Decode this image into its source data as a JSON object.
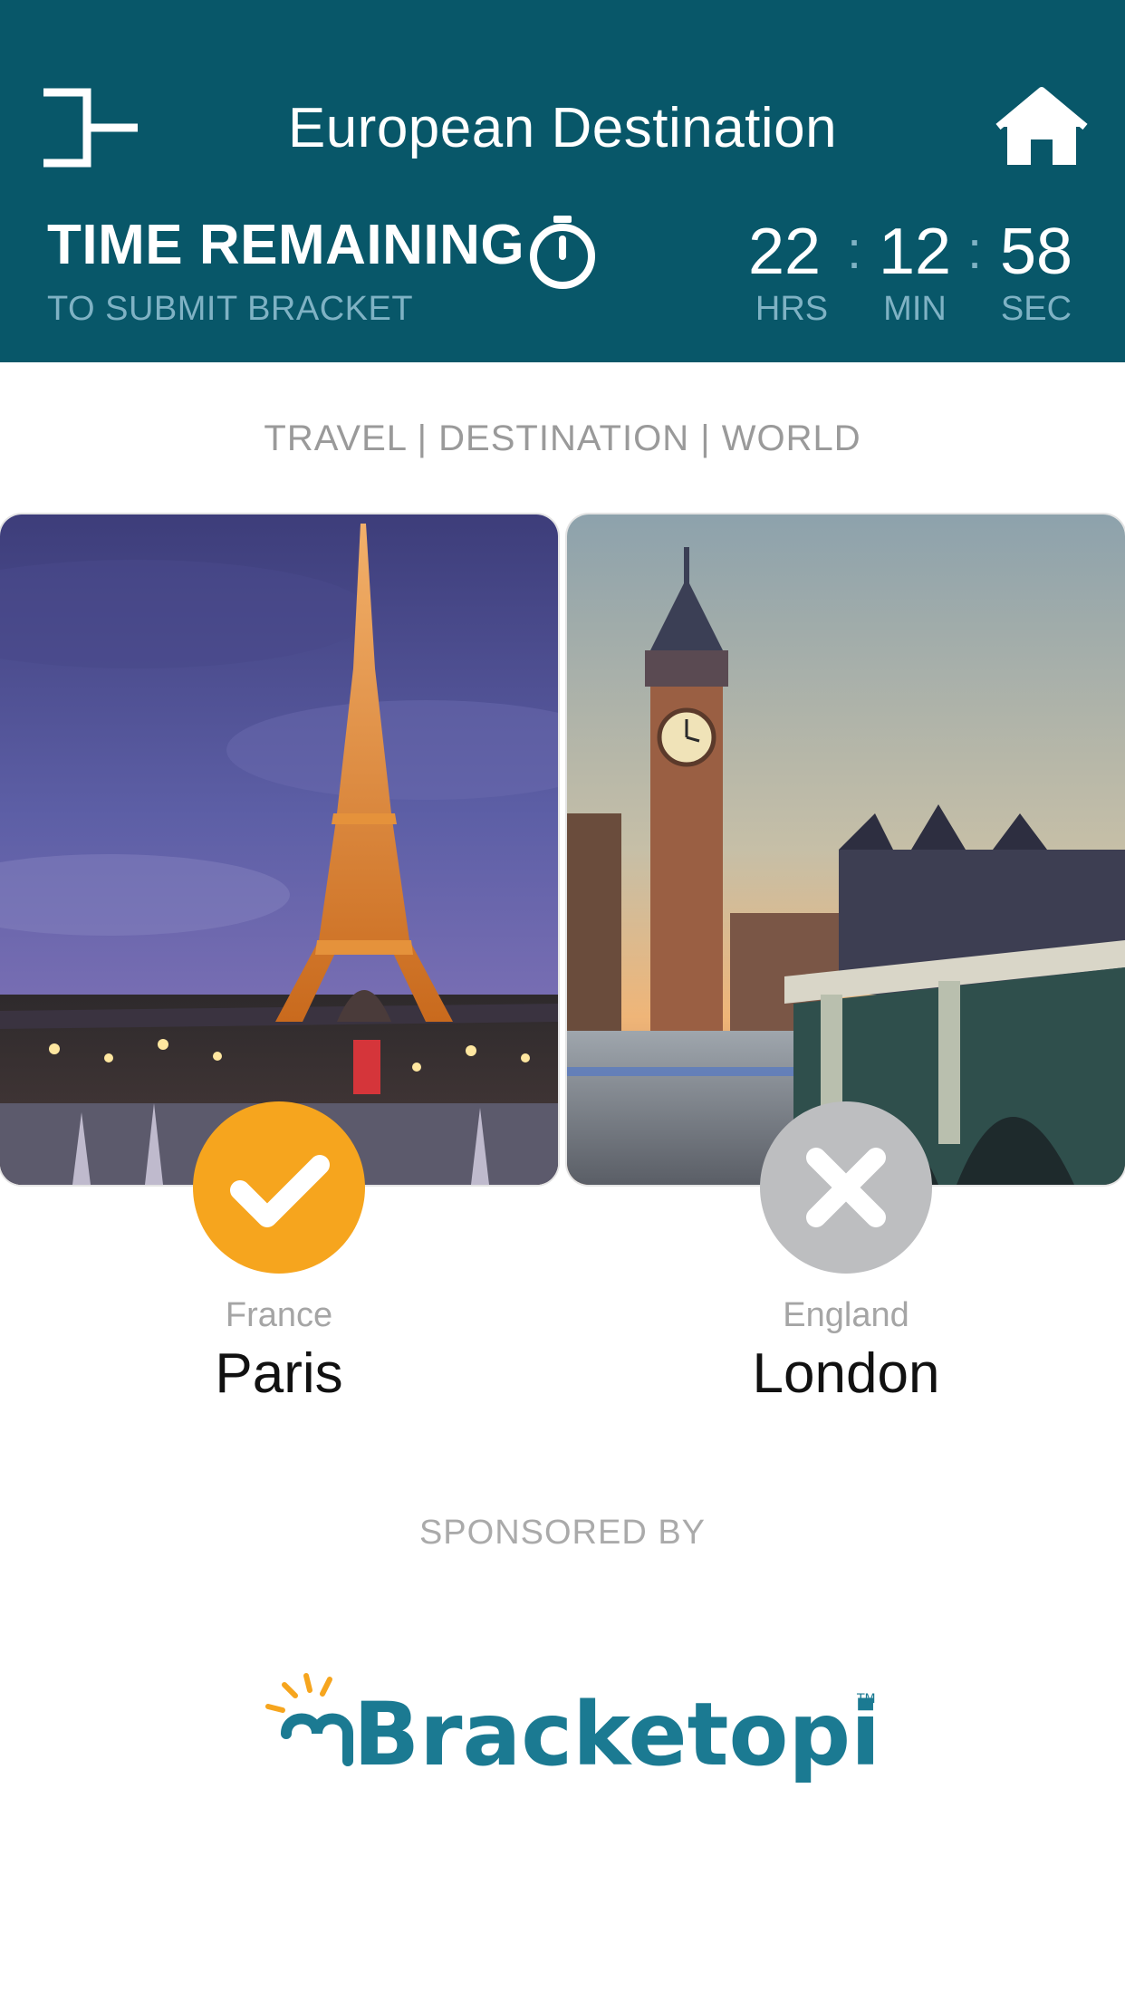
{
  "header": {
    "title": "European Destination",
    "time_label": "TIME REMAINING",
    "time_sublabel": "TO SUBMIT BRACKET",
    "countdown": {
      "hours": "22",
      "minutes": "12",
      "seconds": "58",
      "separator": ":"
    },
    "units": {
      "hours": "HRS",
      "minutes": "MIN",
      "seconds": "SEC"
    }
  },
  "categories": "TRAVEL | DESTINATION | WORLD",
  "matchup": {
    "left": {
      "country": "France",
      "city": "Paris",
      "image": "eiffel-tower-photo",
      "state": "selected",
      "button_icon": "check-icon"
    },
    "right": {
      "country": "England",
      "city": "London",
      "image": "big-ben-photo",
      "state": "not-selected",
      "button_icon": "close-icon"
    }
  },
  "sponsor": {
    "label": "SPONSORED BY",
    "logo_text": "Bracketopia",
    "trademark": "TM"
  },
  "colors": {
    "header_bg": "#085769",
    "selected": "#F6A51E",
    "unselected": "#BDBEC0",
    "brand": "#1B7A92",
    "sun": "#F6A51E"
  }
}
